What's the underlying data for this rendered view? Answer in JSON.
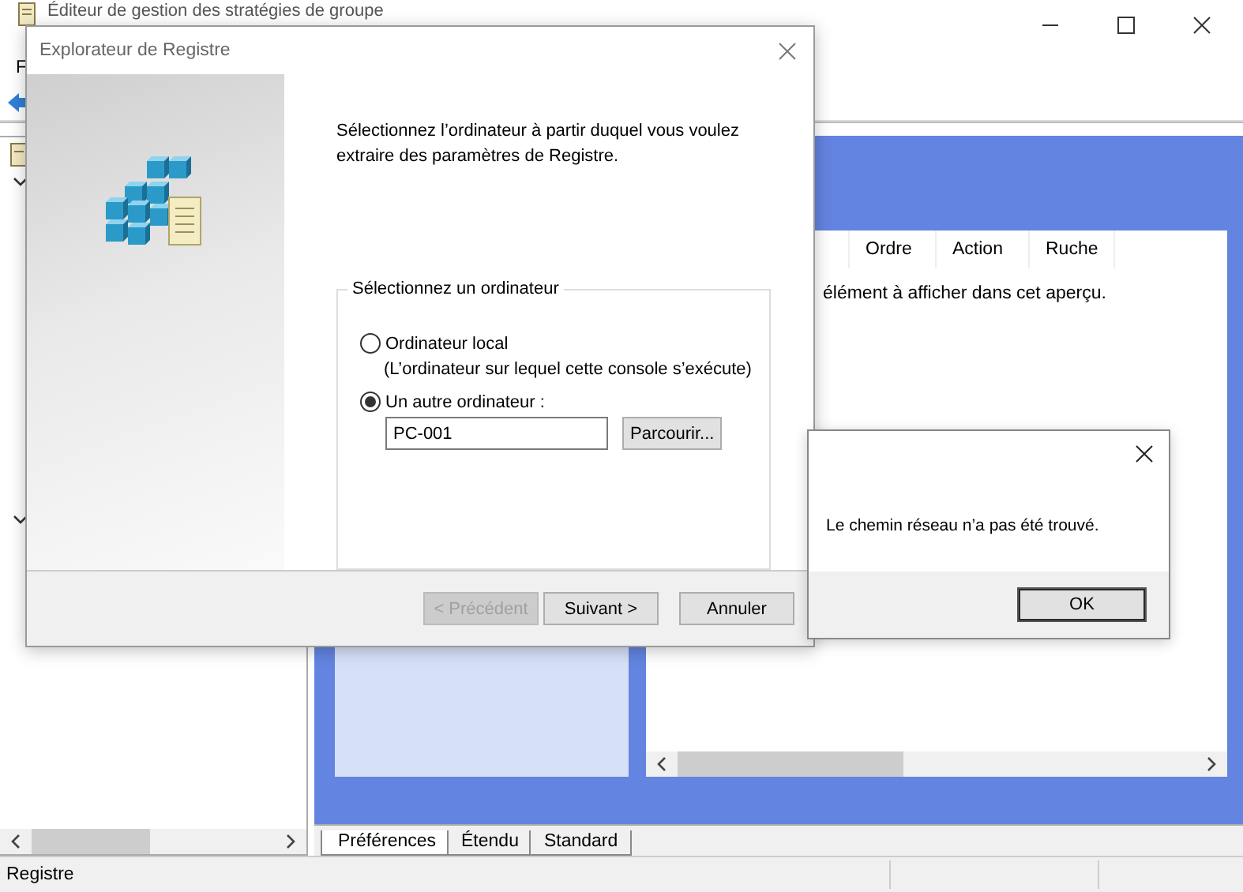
{
  "main_window": {
    "title": "Éditeur de gestion des stratégies de groupe",
    "menu": [
      "F"
    ],
    "list": {
      "columns": [
        "Ordre",
        "Action",
        "Ruche"
      ],
      "empty_message": "élément à afficher dans cet aperçu."
    },
    "tabs": [
      {
        "label": "Préférences",
        "selected": true
      },
      {
        "label": "Étendu",
        "selected": false
      },
      {
        "label": "Standard",
        "selected": false
      }
    ],
    "status_bar": [
      "Registre"
    ]
  },
  "wizard": {
    "title": "Explorateur de Registre",
    "instruction": "Sélectionnez l’ordinateur à partir duquel vous voulez extraire des paramètres de Registre.",
    "group_label": "Sélectionnez un ordinateur",
    "options": [
      {
        "label": "Ordinateur local",
        "description": "(L’ordinateur sur lequel cette console s’exécute)",
        "selected": false
      },
      {
        "label": "Un autre ordinateur :",
        "selected": true
      }
    ],
    "computer_name": "PC-001",
    "browse_button": "Parcourir...",
    "buttons": [
      {
        "label": "< Précédent",
        "disabled": true
      },
      {
        "label": "Suivant >",
        "disabled": false
      },
      {
        "label": "Annuler",
        "disabled": false
      }
    ]
  },
  "message_box": {
    "message": "Le chemin réseau n’a pas été trouvé.",
    "button": "OK"
  }
}
